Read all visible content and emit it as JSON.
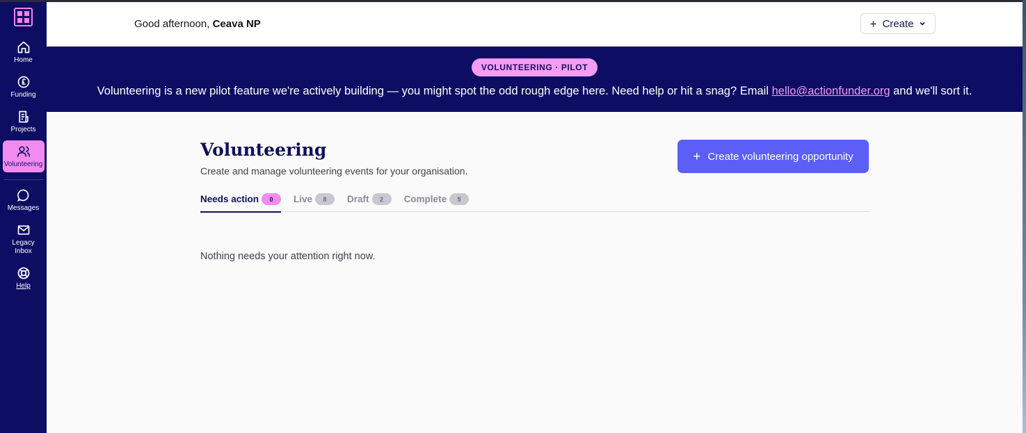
{
  "sidebar": {
    "items": [
      {
        "label": "Home",
        "icon": "home-icon"
      },
      {
        "label": "Funding",
        "icon": "pound-icon"
      },
      {
        "label": "Projects",
        "icon": "document-icon"
      },
      {
        "label": "Volunteering",
        "icon": "users-icon",
        "active": true
      },
      {
        "label": "Messages",
        "icon": "chat-icon"
      },
      {
        "label": "Legacy Inbox",
        "icon": "mail-icon"
      },
      {
        "label": "Help",
        "icon": "lifebuoy-icon"
      }
    ]
  },
  "header": {
    "greeting_prefix": "Good afternoon,",
    "user_name": "Ceava NP",
    "create_label": "Create"
  },
  "banner": {
    "pill": "VOLUNTEERING · PILOT",
    "text_before": "Volunteering is a new pilot feature we're actively building — you might spot the odd rough edge here. Need help or hit a snag? Email ",
    "email": "hello@actionfunder.org",
    "text_after": " and we'll sort it."
  },
  "main": {
    "title": "Volunteering",
    "subtitle": "Create and manage volunteering events for your organisation.",
    "primary_button": "Create volunteering opportunity",
    "tabs": [
      {
        "label": "Needs action",
        "count": "0"
      },
      {
        "label": "Live",
        "count": "8"
      },
      {
        "label": "Draft",
        "count": "2"
      },
      {
        "label": "Complete",
        "count": "5"
      }
    ],
    "empty_message": "Nothing needs your attention right now."
  },
  "colors": {
    "navy": "#0d0d63",
    "pink": "#f28bf0",
    "primary": "#5b5ef7"
  }
}
